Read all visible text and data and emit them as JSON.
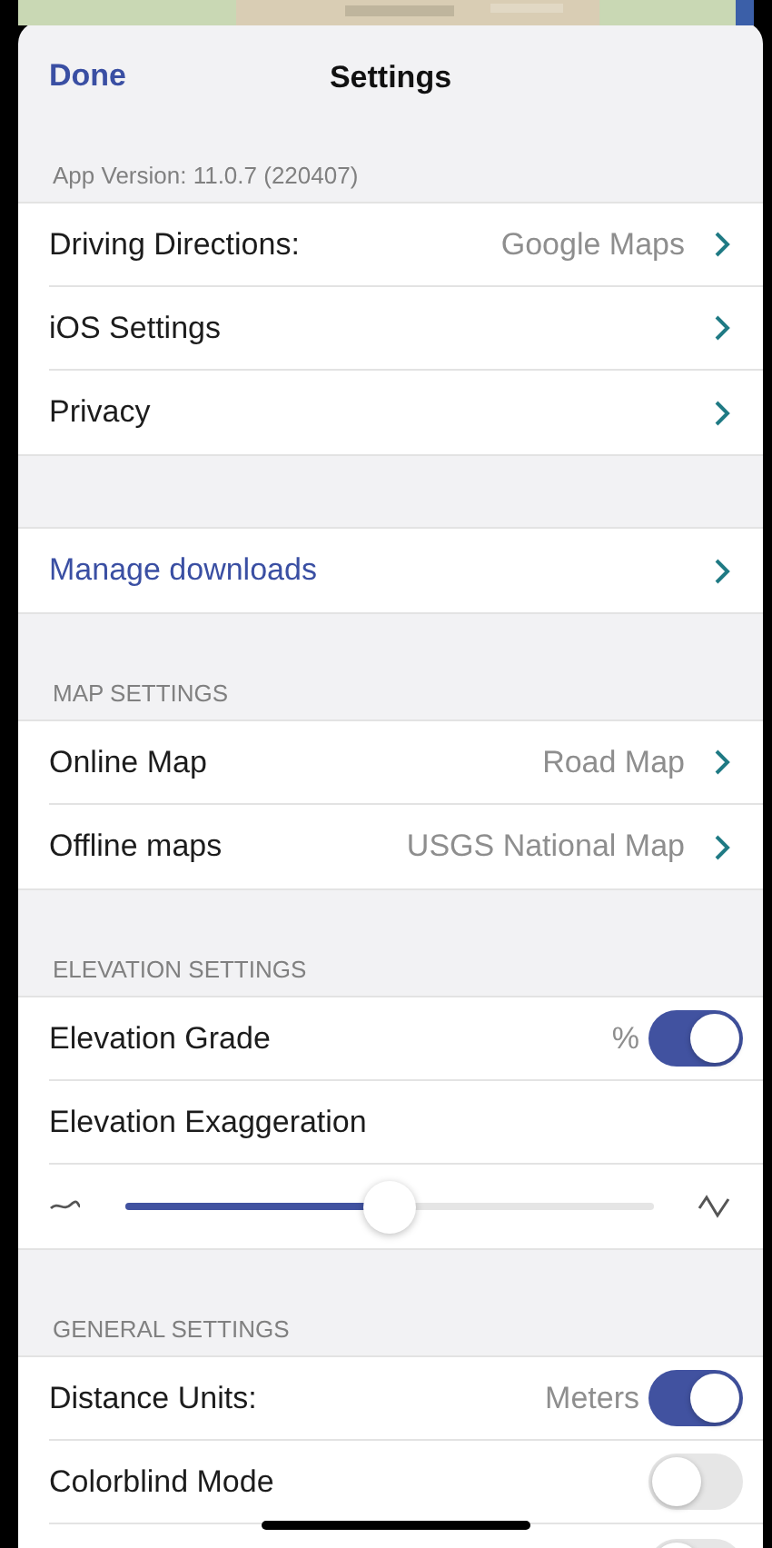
{
  "nav": {
    "done": "Done",
    "title": "Settings"
  },
  "sections": [
    {
      "header": "App Version: 11.0.7 (220407)",
      "rows": [
        {
          "kind": "nav",
          "label": "Driving Directions:",
          "value": "Google Maps"
        },
        {
          "kind": "nav",
          "label": "iOS Settings"
        },
        {
          "kind": "nav",
          "label": "Privacy"
        }
      ]
    },
    {
      "rows": [
        {
          "kind": "link",
          "label": "Manage downloads"
        }
      ]
    },
    {
      "header": "MAP SETTINGS",
      "rows": [
        {
          "kind": "nav",
          "label": "Online Map",
          "value": "Road Map"
        },
        {
          "kind": "nav",
          "label": "Offline maps",
          "value": "USGS National Map"
        }
      ]
    },
    {
      "header": "ELEVATION SETTINGS",
      "rows": [
        {
          "kind": "toggle",
          "label": "Elevation Grade",
          "value": "%",
          "on": true
        },
        {
          "kind": "plain",
          "label": "Elevation Exaggeration"
        },
        {
          "kind": "slider",
          "level": 0.5
        }
      ]
    },
    {
      "header": "GENERAL SETTINGS",
      "rows": [
        {
          "kind": "toggle",
          "label": "Distance Units:",
          "value": "Meters",
          "on": true
        },
        {
          "kind": "toggle",
          "label": "Colorblind Mode",
          "on": false
        },
        {
          "kind": "toggle",
          "on": false
        }
      ]
    }
  ]
}
